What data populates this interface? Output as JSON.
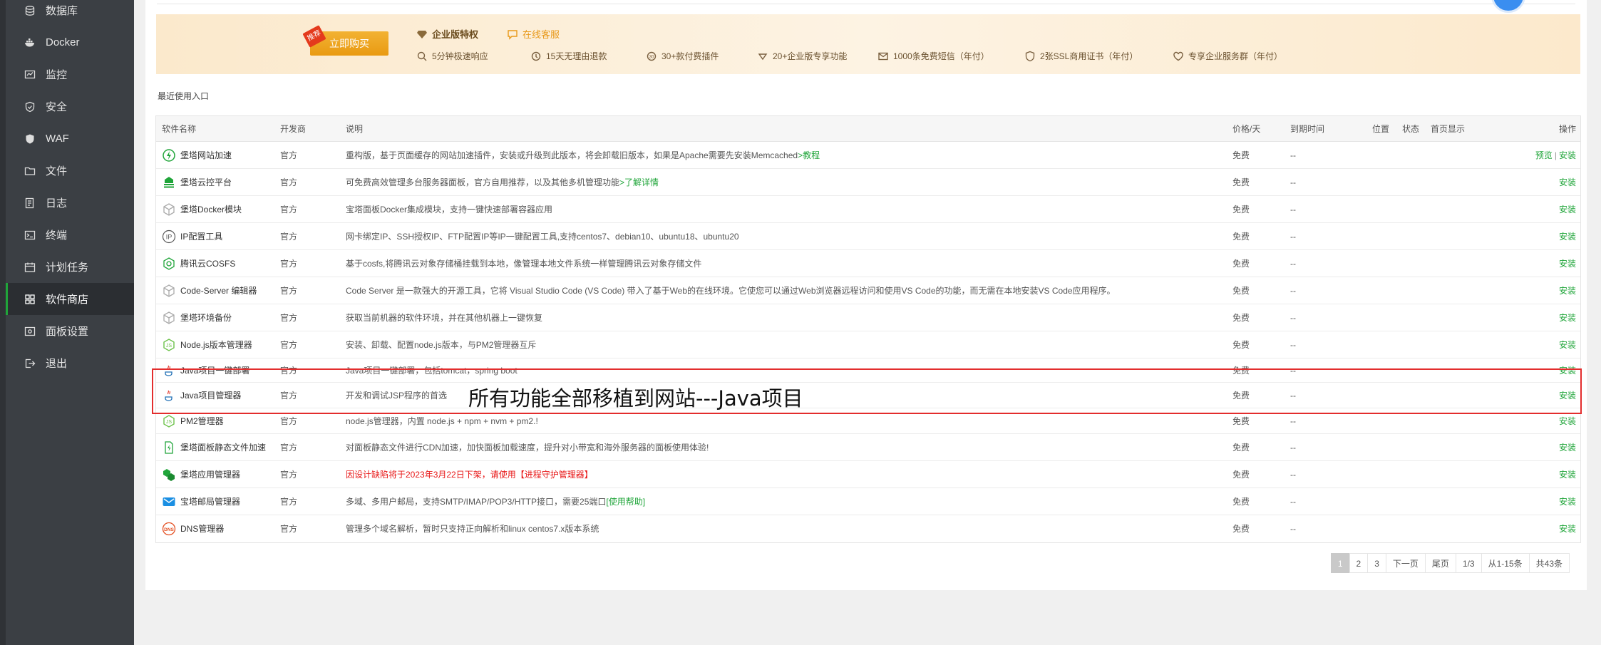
{
  "sidebar": {
    "items": [
      {
        "label": "数据库",
        "icon": "database-icon"
      },
      {
        "label": "Docker",
        "icon": "docker-icon"
      },
      {
        "label": "监控",
        "icon": "monitor-icon"
      },
      {
        "label": "安全",
        "icon": "shield-icon"
      },
      {
        "label": "WAF",
        "icon": "waf-shield-icon"
      },
      {
        "label": "文件",
        "icon": "folder-icon"
      },
      {
        "label": "日志",
        "icon": "log-icon"
      },
      {
        "label": "终端",
        "icon": "terminal-icon"
      },
      {
        "label": "计划任务",
        "icon": "calendar-icon"
      },
      {
        "label": "软件商店",
        "icon": "grid-icon",
        "active": true
      },
      {
        "label": "面板设置",
        "icon": "settings-icon"
      },
      {
        "label": "退出",
        "icon": "logout-icon"
      }
    ]
  },
  "banner": {
    "hot_tag": "推荐",
    "buy_button": "立即购买",
    "vip_title": "企业版特权",
    "online_service": "在线客服",
    "features": [
      "5分钟极速响应",
      "15天无理由退款",
      "30+款付费插件",
      "20+企业版专享功能",
      "1000条免费短信（年付）",
      "2张SSL商用证书（年付）",
      "专享企业服务群（年付）"
    ]
  },
  "recent_label": "最近使用入口",
  "table": {
    "headers": {
      "name": "软件名称",
      "developer": "开发商",
      "description": "说明",
      "price": "价格/天",
      "expire": "到期时间",
      "location": "位置",
      "status": "状态",
      "homepage": "首页显示",
      "ops": "操作"
    },
    "rows": [
      {
        "name": "堡塔网站加速",
        "dev": "官方",
        "desc": "重构版，基于页面缓存的网站加速插件，安装或升级到此版本，将会卸载旧版本，如果是Apache需要先安装Memcached",
        "desc_link": ">教程",
        "price": "免费",
        "expire": "--",
        "preview": "预览",
        "install": "安装"
      },
      {
        "name": "堡塔云控平台",
        "dev": "官方",
        "desc": "可免费高效管理多台服务器面板，官方自用推荐，以及其他多机管理功能",
        "desc_link": ">了解详情",
        "price": "免费",
        "expire": "--",
        "install": "安装"
      },
      {
        "name": "堡塔Docker模块",
        "dev": "官方",
        "desc": "宝塔面板Docker集成模块，支持一键快速部署容器应用",
        "price": "免费",
        "expire": "--",
        "install": "安装"
      },
      {
        "name": "IP配置工具",
        "dev": "官方",
        "desc": "网卡绑定IP、SSH授权IP、FTP配置IP等IP一键配置工具,支持centos7、debian10、ubuntu18、ubuntu20",
        "price": "免费",
        "expire": "--",
        "install": "安装"
      },
      {
        "name": "腾讯云COSFS",
        "dev": "官方",
        "desc": "基于cosfs,将腾讯云对象存储桶挂载到本地，像管理本地文件系统一样管理腾讯云对象存储文件",
        "price": "免费",
        "expire": "--",
        "install": "安装"
      },
      {
        "name": "Code-Server 编辑器",
        "dev": "官方",
        "desc": "Code Server 是一款强大的开源工具，它将 Visual Studio Code (VS Code) 带入了基于Web的在线环境。它使您可以通过Web浏览器远程访问和使用VS Code的功能，而无需在本地安装VS Code应用程序。",
        "price": "免费",
        "expire": "--",
        "install": "安装"
      },
      {
        "name": "堡塔环境备份",
        "dev": "官方",
        "desc": "获取当前机器的软件环境，并在其他机器上一键恢复",
        "price": "免费",
        "expire": "--",
        "install": "安装"
      },
      {
        "name": "Node.js版本管理器",
        "dev": "官方",
        "desc": "安装、卸载、配置node.js版本，与PM2管理器互斥",
        "price": "免费",
        "expire": "--",
        "install": "安装"
      },
      {
        "name": "Java项目一键部署",
        "dev": "官方",
        "desc": "Java项目一键部署，包括tomcat，spring boot",
        "price": "免费",
        "expire": "--",
        "install": "安装"
      },
      {
        "name": "Java项目管理器",
        "dev": "官方",
        "desc": "开发和调试JSP程序的首选",
        "price": "免费",
        "expire": "--",
        "install": "安装"
      },
      {
        "name": "PM2管理器",
        "dev": "官方",
        "desc": "node.js管理器，内置 node.js + npm + nvm + pm2.!",
        "price": "免费",
        "expire": "--",
        "install": "安装"
      },
      {
        "name": "堡塔面板静态文件加速",
        "dev": "官方",
        "desc": "对面板静态文件进行CDN加速，加快面板加载速度，提升对小带宽和海外服务器的面板使用体验!",
        "price": "免费",
        "expire": "--",
        "install": "安装"
      },
      {
        "name": "堡塔应用管理器",
        "dev": "官方",
        "desc_red": "因设计缺陷将于2023年3月22日下架，请使用【进程守护管理器】",
        "price": "免费",
        "expire": "--",
        "install": "安装"
      },
      {
        "name": "宝塔邮局管理器",
        "dev": "官方",
        "desc": "多域、多用户邮局，支持SMTP/IMAP/POP3/HTTP接口，需要25端口",
        "desc_link": "[使用帮助]",
        "price": "免费",
        "expire": "--",
        "install": "安装"
      },
      {
        "name": "DNS管理器",
        "dev": "官方",
        "desc": "管理多个域名解析，暂时只支持正向解析和linux centos7.x版本系统",
        "price": "免费",
        "expire": "--",
        "install": "安装"
      }
    ]
  },
  "annotation": {
    "caption": "所有功能全部移植到网站---Java项目"
  },
  "pagination": {
    "pages": [
      "1",
      "2",
      "3"
    ],
    "next": "下一页",
    "last": "尾页",
    "page_info": "1/3",
    "range": "从1-15条",
    "total": "共43条"
  },
  "colors": {
    "accent": "#20a53a",
    "sidebar": "#3b3f44",
    "highlight": "#e32d2d",
    "warning_text": "#e81717"
  }
}
